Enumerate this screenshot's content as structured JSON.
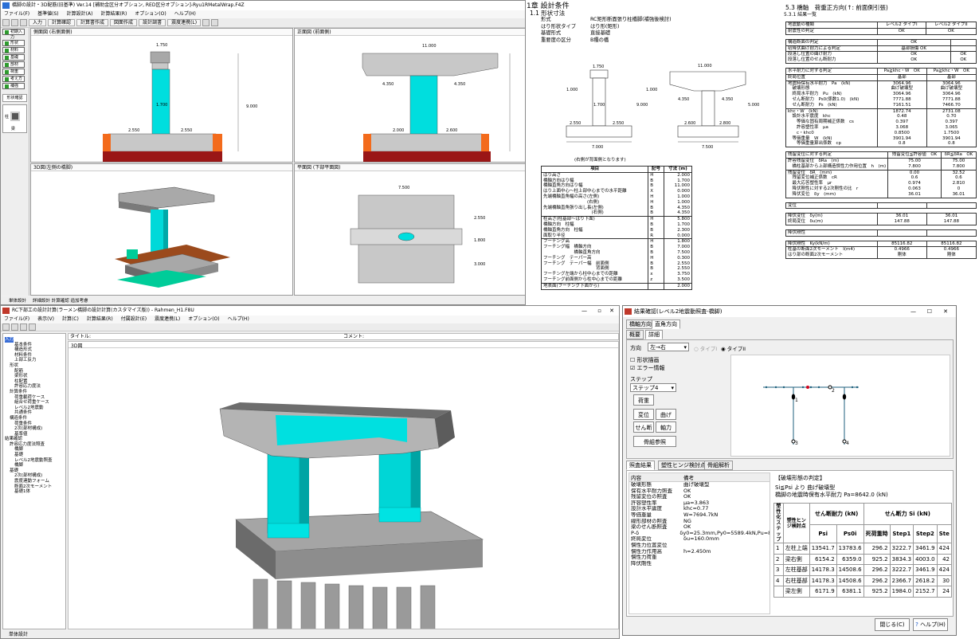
{
  "main": {
    "title": "橋脚の設計・3D配筋(旧基準) Ver.14 [補助金区分オプション, RED区分オプション]-Ryu1RMetalWrap.F4Z",
    "menu": [
      "ファイル(F)",
      "基準値(S)",
      "計算設計(A)",
      "計算結果(R)",
      "オプション(O)",
      "ヘルプ(H)"
    ],
    "toolbar": [
      "入力",
      "計算確認",
      "計算書作成",
      "図面作成",
      "設計調書",
      "震度連携(L)"
    ],
    "nav": [
      "初期入力",
      "形状",
      "材料",
      "基礎",
      "部材",
      "荷重",
      "考え方",
      "補強"
    ],
    "nav_group": "形状確認",
    "nav_group_items": [
      "柱",
      "梁"
    ],
    "panes": {
      "side": "側面図 (右側面側)",
      "front": "正面図 (前面側)",
      "iso": "3D図(左側の橋脚)",
      "plan": "平面図 (下部平面図)",
      "comment": "コメント:"
    },
    "tabs": [
      "単体設計",
      "詳細設計 計算確認 追加考慮"
    ]
  },
  "dims_side": [
    "1.750",
    "1.700",
    "9.000",
    "2.550",
    "2.550",
    "7.000"
  ],
  "dims_front": [
    "11.000",
    "4.350",
    "4.350",
    "2.000",
    "2.600",
    "2.800",
    "7.500",
    "1.000",
    "1.000"
  ],
  "dims_plan": [
    "7.500",
    "2.550",
    "1.800",
    "3.000"
  ],
  "doc1": {
    "chapter": "1章 設計条件",
    "section": "1.1 形状寸法",
    "rows": [
      [
        "形式",
        "RC矩形断面張り柱橋脚(補強後検討)"
      ],
      [
        "はり形状タイプ",
        "はり形(矩形)"
      ],
      [
        "基礎形式",
        "直接基礎"
      ],
      [
        "重要度の区分",
        "B種の橋"
      ]
    ],
    "dims": [
      "1.750",
      "1.700",
      "11.000",
      "9.000",
      "4.350",
      "4.350",
      "2.550",
      "2.550",
      "2.600",
      "2.800",
      "7.000",
      "7.500",
      "1.000",
      "1.000",
      "5.000"
    ],
    "caption": "(右側が背面側となります)",
    "table_head": [
      "項目",
      "記号",
      "寸法 (m)"
    ],
    "table_rows": [
      [
        "はり高さ\n橋軸方向はり幅\n橋軸直角方向はり幅\nはり上面中心～柱上部中心までの水平距離\n先端橋軸直角幅の高さ(左側)\n　　　　　　　　　　(右側)\n先端橋軸直角張り出し長(左側)\n　　　　　　　　　　　(右側)",
        "H\nB\nB\nX\nH\nH\nB\nB",
        "2.000\n1.700\n11.000\n0.000\n1.000\n1.000\n4.350\n4.350"
      ],
      [
        "柱高さ(柱基部～はり下面)\n橋軸方向　柱幅\n橋軸直角方向　柱幅\n面取り半径",
        "H\nB\nB\nR",
        "5.800\n1.700\n2.300\n0.000"
      ],
      [
        "フーチング高\nフーチング幅　橋軸方向\n　　　　　　　橋軸直角方向\nフーチング　テーパー高\nフーチング　テーパー幅　前面側\n　　　　　　　　　　　　背面側\nフーチング左端から柱中心までの距離\nフーチング前面側から柱中心までの距離",
        "H\nB\nB\nH\nB\nB\nx\nz",
        "1.800\n7.000\n7.500\n0.300\n2.550\n2.550\n3.750\n3.500"
      ],
      [
        "地表面(フーチング下面から)",
        "",
        "2.000"
      ]
    ]
  },
  "doc2": {
    "title": "5.3 橋軸　荷重正方向(↑: 前面側引張)",
    "sub": "5.3.1 結果一覧",
    "blocks": [
      [
        [
          "地震動の種類",
          "レベル2 タイプI",
          "レベル2 タイプII"
        ],
        [
          "耐震性の判定",
          "OK",
          "OK"
        ]
      ],
      [
        [
          "構造断面の判定",
          "OK",
          ""
        ],
        [
          "初降伏曲げ耐力による判定",
          "基部損傷 OK",
          ""
        ],
        [
          "段落し位置の曲げ耐力\n段落し位置のせん断耐力",
          "OK\nOK",
          "OK\nOK"
        ]
      ],
      [
        [
          "水平耐力に対する判定",
          "Pa≧khc・W　OK",
          "Pa≧khc・W　OK"
        ],
        [
          "終局位置",
          "基部",
          "基部"
        ],
        [
          "地震時保有水平耐力　Pa　(kN)\n　破壊形態\n　終局水平耐力　Pu　(kN)\n　せん断耐力　Ps0(係数1.0)　(kN)\n　せん断耐力　Ps　(kN)",
          "3064.96\n曲げ破壊型\n3064.96\n7771.88\n7161.51",
          "3064.96\n曲げ破壊型\n3064.96\n7771.88\n7466.70"
        ],
        [
          "khc・W　(kN)\n　設計水平震度　khc\n　　等価な固有周期補正係数　cs\n　　許容塑性率　μa\n　　c・khc0\n　等価重量　W　(kN)\n　　等価重量算出係数　cp",
          "1872.74\n0.48\n0.397\n3.068\n0.8500\n3901.94\n0.8",
          "2731.08\n0.70\n0.397\n3.065\n1.7500\n3901.94\n0.8"
        ]
      ],
      [
        [
          "残留変位に対する判定",
          "残留変位≦許容値　OK",
          "δR≦δRa　OK"
        ],
        [
          "許容残留変位　δRa　(m)\n　橋柱基部から上部構造慣性力作用位置　h　(m)",
          "75.00\n7.800",
          "75.00\n7.800"
        ],
        [
          "残留変位　δR　(mm)\n　残留変位補正係数　cR\n　最大応答塑性率　μr\n　降伏剛性に対する2次剛性の比　r\n　降伏変位　δy　(mm)",
          "0.00\n0.6\n0.974\n0.063\n36.01",
          "32.52\n0.6\n2.810\n0\n36.01"
        ]
      ],
      [
        [
          "変位",
          "",
          ""
        ]
      ],
      [
        [
          "降伏変位　δy(m)\n終局変位　δu(m)",
          "36.01\n147.88",
          "36.01\n147.88"
        ]
      ],
      [
        [
          "降伏剛性",
          "",
          ""
        ]
      ],
      [
        [
          "降伏剛性　Ky(kN/m)",
          "85116.82",
          "85116.82"
        ],
        [
          "柱基の断面2次モーメント　I(m4)\nはり部の断面2次モーメント",
          "0.4966\n剛体",
          "0.4966\n剛体"
        ]
      ]
    ]
  },
  "frame": {
    "title": "RC下部工の設計計算(ラーメン橋脚の設計計算(カスタマイズ版)) - Rahmen_H1.F8U",
    "menu": [
      "ファイル(F)",
      "表示(V)",
      "計算(C)",
      "計算結果(R)",
      "付属設計(E)",
      "震度連携(L)",
      "オプション(O)",
      "ヘルプ(H)"
    ],
    "title_field": "タイトル:",
    "comment_field": "コメント:",
    "view": "3D図",
    "status": "単体設計",
    "tree": [
      "入力",
      "基本条件",
      "構造形式",
      "材料条件",
      "上部工反力",
      "形状",
      "配筋",
      "梁形状",
      "柱配置",
      "許容応力度法",
      "計算条件",
      "荷重載荷ケース",
      "組合せ荷重ケース",
      "レベル2地震動",
      "共通条件",
      "構造条件",
      "荷重条件",
      "2次(部材構成)",
      "基準値",
      "結果確認",
      "許容応力度法照査",
      "橋脚",
      "基礎",
      "レベル2地震動照査",
      "橋脚",
      "基礎",
      "2次(部材構成)",
      "震度連動フォーム",
      "断面2次モーメント",
      "基礎1体"
    ]
  },
  "dlg": {
    "title": "結果確認(レベル2地震動照査-橋脚)",
    "top_tabs": [
      "橋軸方向",
      "直角方向"
    ],
    "sub_tabs": [
      "概要",
      "詳細"
    ],
    "dir_label": "方向",
    "dir_value": "左→右",
    "type1": "タイプI",
    "type2": "タイプII",
    "cb_shape": "形状描画",
    "cb_error": "エラー情報",
    "step_label": "ステップ",
    "step_value": "ステップ4",
    "btns": [
      "荷重",
      "変位",
      "曲げ",
      "せん断",
      "軸力",
      "骨組参照"
    ],
    "lower_tabs": [
      "照査結果",
      "塑性ヒンジ検討点",
      "骨組解析"
    ],
    "kv_head": [
      "内容",
      "備考"
    ],
    "kv": [
      [
        "破壊形態",
        "曲げ破壊型"
      ],
      [
        "保有水平耐力照査",
        "OK"
      ],
      [
        "残留変位の照査",
        "OK"
      ],
      [
        "許容塑性率",
        "μa=3.863"
      ],
      [
        "設計水平震度",
        "khc=0.77"
      ],
      [
        "等価重量",
        "W=7694.7kN"
      ],
      [
        "線形部材の照査",
        "NG"
      ],
      [
        "梁のせん断照査",
        "OK"
      ],
      [
        "P-δ",
        "δy0=25.3mm,Py0=5589.4kN,Pu=8..."
      ],
      [
        "終局変位",
        "δu=160.0mm"
      ],
      [
        "慣性力位置変位",
        ""
      ],
      [
        "慣性力作用高",
        "h=2.450m"
      ],
      [
        "慣性力荷重",
        ""
      ],
      [
        "降伏剛性",
        ""
      ]
    ],
    "judge_head": "【破壊形態の判定】",
    "judge1": "Si≦Psi より 曲げ破壊型",
    "judge2": "橋脚の地震時保有水平耐力  Pa=8642.0 (kN)",
    "res_head": [
      "塑性化ステップ",
      "塑性ヒンジ検討点",
      "せん断耐力 (kN)",
      "せん断力 Si (kN)"
    ],
    "res_sub": [
      "Psi",
      "Ps0i",
      "死荷重時",
      "Step1",
      "Step2",
      "Ste"
    ],
    "res_rows": [
      [
        "1",
        "左柱上端",
        "13541.7",
        "13783.6",
        "296.2",
        "3222.7",
        "3461.9",
        "424"
      ],
      [
        "2",
        "梁右側",
        "6154.2",
        "6359.0",
        "925.2",
        "3834.3",
        "4003.0",
        "42"
      ],
      [
        "3",
        "左柱基部",
        "14178.3",
        "14508.6",
        "296.2",
        "3222.7",
        "3461.9",
        "424"
      ],
      [
        "4",
        "右柱基部",
        "14178.3",
        "14508.6",
        "296.2",
        "2366.7",
        "2618.2",
        "30"
      ],
      [
        "",
        "梁左側",
        "6171.9",
        "6381.1",
        "925.2",
        "1984.0",
        "2152.7",
        "24"
      ]
    ],
    "close": "閉じる(C)",
    "help": "ヘルプ(H)",
    "node_labels": [
      "1",
      "2",
      "3",
      "4"
    ]
  }
}
